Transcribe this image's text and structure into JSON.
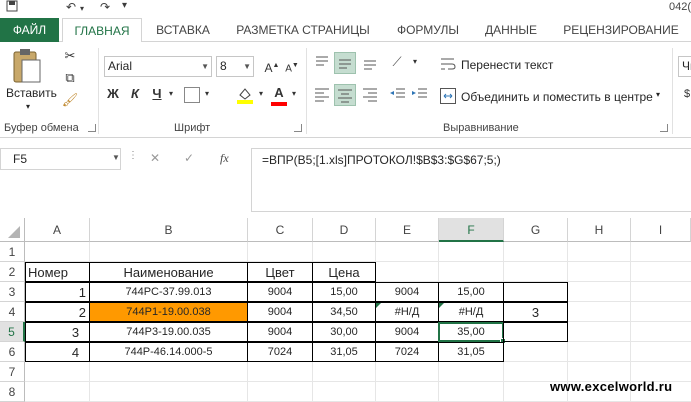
{
  "window": {
    "filename_fragment": "042("
  },
  "tabs": [
    {
      "label": "ФАЙЛ"
    },
    {
      "label": "ГЛАВНАЯ"
    },
    {
      "label": "ВСТАВКА"
    },
    {
      "label": "РАЗМЕТКА СТРАНИЦЫ"
    },
    {
      "label": "ФОРМУЛЫ"
    },
    {
      "label": "ДАННЫЕ"
    },
    {
      "label": "РЕЦЕНЗИРОВАНИЕ"
    }
  ],
  "ribbon": {
    "clipboard": {
      "paste_label": "Вставить",
      "group_label": "Буфер обмена"
    },
    "font": {
      "font_name": "Arial",
      "font_size": "8",
      "bold": "Ж",
      "italic": "К",
      "underline": "Ч",
      "font_color_glyph": "А",
      "group_label": "Шрифт"
    },
    "alignment": {
      "wrap_label": "Перенести текст",
      "merge_label": "Объединить и поместить в центре",
      "group_label": "Выравнивание"
    },
    "number": {
      "format_fragment": "Чи"
    }
  },
  "formula_bar": {
    "name_box": "F5",
    "cancel": "✕",
    "enter": "✓",
    "fx": "fx",
    "formula": "=ВПР(B5;[1.xls]ПРОТОКОЛ!$B$3:$G$67;5;)"
  },
  "columns": [
    "A",
    "B",
    "C",
    "D",
    "E",
    "F",
    "G",
    "H",
    "I"
  ],
  "rows": [
    "1",
    "2",
    "3",
    "4",
    "5",
    "6",
    "7",
    "8"
  ],
  "sheet": {
    "header": {
      "a": "Номер",
      "b": "Наименование",
      "c": "Цвет",
      "d": "Цена"
    },
    "data": [
      {
        "a": "1",
        "b": "744РС-37.99.013",
        "c": "9004",
        "d": "15,00",
        "e": "9004",
        "f": "15,00",
        "g": ""
      },
      {
        "a": "2",
        "b": "744Р1-19.00.038",
        "c": "9004",
        "d": "34,50",
        "e": "#Н/Д",
        "f": "#Н/Д",
        "g": "3"
      },
      {
        "a": "3",
        "b": "744Р3-19.00.035",
        "c": "9004",
        "d": "30,00",
        "e": "9004",
        "f": "35,00",
        "g": ""
      },
      {
        "a": "4",
        "b": "744Р-46.14.000-5",
        "c": "7024",
        "d": "31,05",
        "e": "7024",
        "f": "31,05",
        "g": ""
      }
    ]
  },
  "colors": {
    "accent": "#217346",
    "highlight": "#FF9900"
  },
  "watermark": "www.excelworld.ru"
}
